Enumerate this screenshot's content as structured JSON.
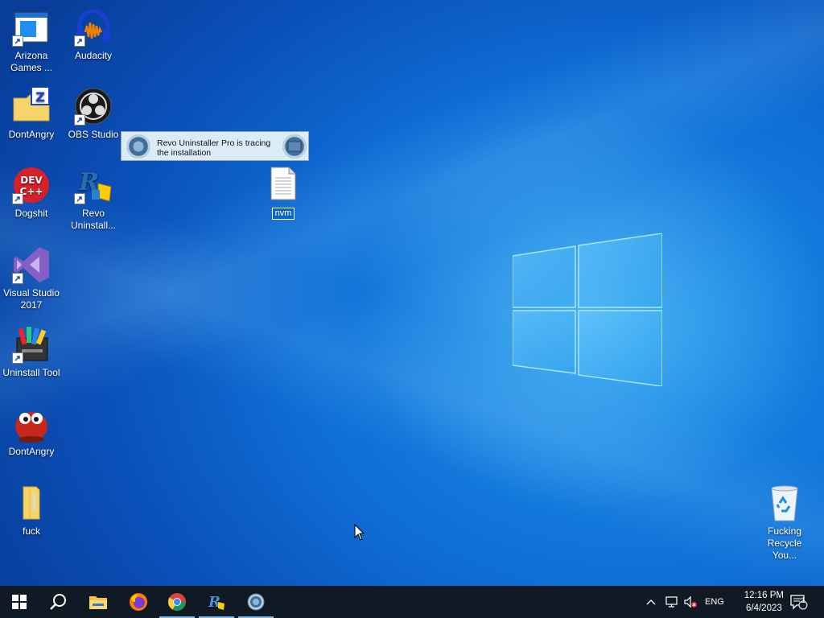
{
  "desktop": {
    "icons": [
      {
        "label": "Arizona Games ...",
        "icon": "window-app-icon"
      },
      {
        "label": "Audacity",
        "icon": "audacity-headphones-icon"
      },
      {
        "label": "DontAngry",
        "icon": "zip-folder-icon"
      },
      {
        "label": "OBS Studio",
        "icon": "obs-icon"
      },
      {
        "label": "Dogshit",
        "icon": "devcpp-icon"
      },
      {
        "label": "Revo Uninstall...",
        "icon": "revo-uninstaller-icon"
      },
      {
        "label": "Visual Studio 2017",
        "icon": "visual-studio-icon"
      },
      {
        "label": "Uninstall Tool",
        "icon": "uninstall-tool-icon"
      },
      {
        "label": "DontAngry",
        "icon": "red-bird-icon"
      },
      {
        "label": "fuck",
        "icon": "folder-icon"
      },
      {
        "label": "Fucking Recycle You...",
        "icon": "recycle-bin-icon"
      }
    ],
    "file": {
      "label": "nvm",
      "icon": "text-file-icon"
    }
  },
  "tooltip": {
    "line1": "Revo Uninstaller Pro is tracing",
    "line2": "the installation"
  },
  "taskbar": {
    "buttons": [
      "start-icon",
      "search-icon",
      "file-explorer-icon",
      "firefox-icon",
      "chrome-icon",
      "revo-uninstaller-icon",
      "revo-tracer-icon"
    ],
    "tray": {
      "language": "ENG",
      "time": "12:16 PM",
      "date": "6/4/2023",
      "notification_count": "1"
    }
  },
  "colors": {
    "accent": "#0a64c8",
    "taskbar": "#101a24"
  }
}
